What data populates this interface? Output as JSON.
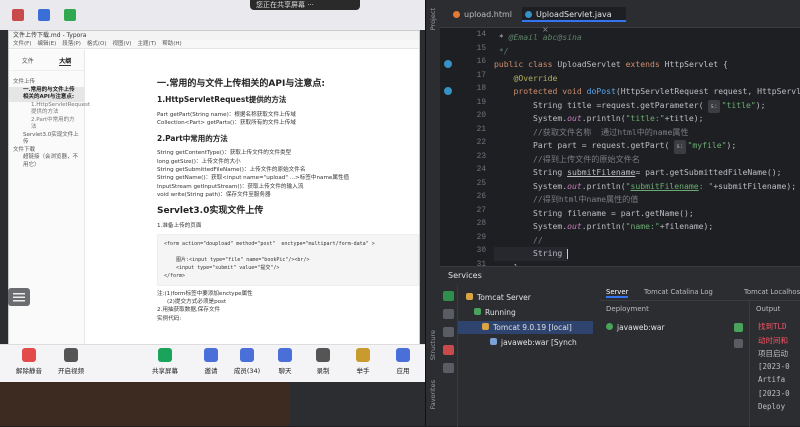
{
  "share_banner": "您正在共享屏幕  ···",
  "typora": {
    "title": "文件上传下载.md - Typora",
    "menu": [
      "文件(F)",
      "编辑(E)",
      "段落(P)",
      "格式(O)",
      "视图(V)",
      "主题(T)",
      "帮助(H)"
    ],
    "sidebar_tabs": [
      "文件",
      "大纲"
    ],
    "toc": [
      {
        "label": "文件上传",
        "level": 1
      },
      {
        "label": "一.常用的与文件上传相关的API与注意点:",
        "level": 2,
        "selected": true
      },
      {
        "label": "1.HttpServletRequest提供的方法",
        "level": 3
      },
      {
        "label": "2.Part中常用的方法",
        "level": 3
      },
      {
        "label": "Servlet3.0实现文件上传",
        "level": 2
      },
      {
        "label": "文件下载",
        "level": 1
      },
      {
        "label": "超链接（会浏览器，不用它）",
        "level": 2
      }
    ],
    "doc": {
      "h1": "一.常用的与文件上传相关的API与注意点:",
      "h2a": "1.HttpServletRequest提供的方法",
      "req_lines": [
        "Part getPart(String name)：根据名称获取文件上传域",
        "Collection<Part> getParts()：获取所有的文件上传域"
      ],
      "h2b": "2.Part中常用的方法",
      "part_lines": [
        "String getContentType()：获取上传文件的文件类型",
        "long getSize()：上传文件的大小",
        "String getSubmittedFileName()：上传文件的原始文件名",
        "String getName()：获取<input name=\"upload\" ...>标签中name属性值",
        "InputStream getInputStream()：获取上传文件的输入流",
        "void write(String path)：保存文件至服务器"
      ],
      "h1b": "Servlet3.0实现文件上传",
      "step1": "1.准备上传的页面",
      "code": "<form action=\"doupload\" method=\"post\"  enctype=\"multipart/form-data\" >\n\n    图片:<input type=\"file\" name=\"bookPic\"/><br/>\n    <input type=\"submit\" value=\"提交\"/>\n</form>",
      "notes": [
        "注:(1)form标签中要添加enctype属性",
        "(2)提交方式必须是post",
        "2.用抽获取数据,保存文件",
        "实例代码:"
      ]
    }
  },
  "meeting": {
    "buttons": [
      {
        "label": "解除静音",
        "icon": "mic-muted-icon"
      },
      {
        "label": "开启视频",
        "icon": "video-off-icon"
      },
      {
        "label": "共享屏幕",
        "icon": "share-screen-icon"
      },
      {
        "label": "邀请",
        "icon": "invite-icon"
      },
      {
        "label": "成员(34)",
        "icon": "members-icon"
      },
      {
        "label": "聊天",
        "icon": "chat-icon"
      },
      {
        "label": "录制",
        "icon": "record-icon"
      },
      {
        "label": "举手",
        "icon": "raise-hand-icon"
      },
      {
        "label": "应用",
        "icon": "apps-icon"
      }
    ]
  },
  "ide": {
    "tabs": [
      {
        "label": "upload.html",
        "icon": "html-file-icon",
        "active": false
      },
      {
        "label": "UploadServlet.java",
        "icon": "java-class-icon",
        "active": true
      }
    ],
    "left_bar_labels": [
      "Project",
      "Structure",
      "Favorites"
    ],
    "line_numbers": [
      "14",
      "15",
      "16",
      "17",
      "18",
      "19",
      "20",
      "21",
      "22",
      "23",
      "24",
      "25",
      "26",
      "27",
      "28",
      "29",
      "30",
      "31"
    ],
    "code_lines": [
      {
        "html": " * <span class='doc'>@Email abc@sina</span>"
      },
      {
        "html": " <span class='doc'>*/</span>"
      },
      {
        "html": "<span class='kw'>public class</span> UploadServlet <span class='kw'>extends</span> HttpServlet {"
      },
      {
        "html": "    <span class='ann'>@Override</span>"
      },
      {
        "html": "    <span class='kw'>protected void</span> <span class='fn'>doPost</span>(HttpServletRequest request, HttpServletResponse"
      },
      {
        "html": "        String title =request.getParameter( <span class='sugg'>s:</span><span class='str'>\"title\"</span>);"
      },
      {
        "html": "        System.<span class='fld'>out</span>.println(<span class='str'>\"title:\"</span>+title);"
      },
      {
        "html": "        <span class='cm'>//获取文件名称  通过html中的name属性</span>"
      },
      {
        "html": "        Part part = request.getPart( <span class='sugg'>s:</span><span class='str'>\"myfile\"</span>);"
      },
      {
        "html": "        <span class='cm'>//得到上传文件的原始文件名</span>"
      },
      {
        "html": "        String <u>submitFilename</u>= part.getSubmittedFileName();"
      },
      {
        "html": "        System.<span class='fld'>out</span>.println(<span class='str'>\"<u>submitFilename</u>: \"</span>+submitFilename);"
      },
      {
        "html": "        <span class='cm'>//得到html中name属性的值</span>"
      },
      {
        "html": "        String filename = part.getName();"
      },
      {
        "html": "        System.<span class='fld'>out</span>.println(<span class='str'>\"name:\"</span>+filename);"
      },
      {
        "html": "        <span class='cm'>//</span>"
      },
      {
        "html": "        String <span class='cursor'></span>"
      },
      {
        "html": "    }"
      }
    ],
    "services": {
      "title": "Services",
      "tree": [
        {
          "label": "Tomcat Server",
          "indent": 1
        },
        {
          "label": "Running",
          "indent": 2
        },
        {
          "label": "Tomcat 9.0.19 [local]",
          "indent": 3,
          "selected": true
        },
        {
          "label": "javaweb:war [Synch",
          "indent": 4
        }
      ],
      "tabs": [
        "Server",
        "Tomcat Catalina Log",
        "Tomcat Localhost"
      ],
      "deployment_header": "Deployment",
      "deployment_item": "javaweb:war",
      "output_header": "Output",
      "output_lines": [
        {
          "text": "找到TLD",
          "color": "#f75464"
        },
        {
          "text": "动时间和",
          "color": "#f75464"
        },
        {
          "text": "项目启动",
          "color": "#bcbec4"
        },
        {
          "text": "[2023-0",
          "color": "#bcbec4"
        },
        {
          "text": "Artifa",
          "color": "#bcbec4"
        },
        {
          "text": "[2023-0",
          "color": "#bcbec4"
        },
        {
          "text": "Deploy",
          "color": "#bcbec4"
        }
      ]
    }
  }
}
